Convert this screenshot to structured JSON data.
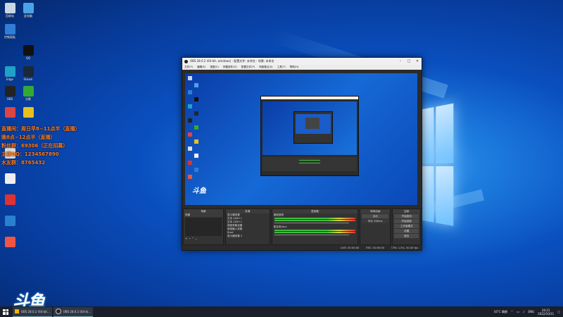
{
  "desktop": {
    "icons": [
      {
        "label": "回收站",
        "color": "#c9d6e6"
      },
      {
        "label": "此电脑",
        "color": "#4aa3e8"
      },
      {
        "label": "控制面板",
        "color": "#2e7dd6"
      },
      {
        "label": "QQ",
        "color": "#111"
      },
      {
        "label": "Edge",
        "color": "#1fa1c8"
      },
      {
        "label": "Steam",
        "color": "#1b2838"
      },
      {
        "label": "OBS",
        "color": "#222"
      },
      {
        "label": "谷歌",
        "color": "#3a3"
      },
      {
        "label": "",
        "color": "#d44"
      },
      {
        "label": "",
        "color": "#e8c020"
      },
      {
        "label": "",
        "color": "#ddd"
      },
      {
        "label": "",
        "color": "#eee"
      },
      {
        "label": "",
        "color": "#d33"
      },
      {
        "label": "",
        "color": "#2a80d0"
      },
      {
        "label": "",
        "color": "#e54"
      }
    ],
    "overlay_lines": [
      "直播间：周日早8~11点半（直播）",
      "晚8点~12点半（直播）",
      "粉丝群：69306（正在招募）",
      "主播QQ：1234567890",
      "水友群：8765432"
    ],
    "watermark": "斗鱼"
  },
  "obs": {
    "title": "OBS 28.0.2 (64-bit, windows) - 配置文件: 未命名 - 场景: 未命名",
    "menu": [
      "文件(F)",
      "编辑(E)",
      "视图(V)",
      "停靠部件(D)",
      "配置文件(P)",
      "场景集合(S)",
      "工具(T)",
      "帮助(H)"
    ],
    "docks": {
      "scenes_header": "场景",
      "scene_item": "场景",
      "sources_header": "来源",
      "sources": [
        "显示器采集",
        "文本 (GDI+)",
        "文本 (GDI+)",
        "视频采集设备",
        "音频输入采集",
        "Start",
        "显示器采集 2"
      ],
      "mixer_header": "混音器",
      "mixer_channels": [
        "桌面音频",
        "麦克风/Aux"
      ],
      "transitions_header": "转场动画",
      "transition_label": "淡出",
      "duration_label": "时长 300ms",
      "controls_header": "控制",
      "controls": [
        "开始推流",
        "开始录制",
        "工作室模式",
        "设置",
        "退出"
      ]
    },
    "status": {
      "live": "LIVE: 00:00:00",
      "rec": "REC: 00:00:00",
      "cpu": "CPU: 1.5%, 30.00 fps"
    }
  },
  "taskbar": {
    "tasks": [
      "OBS 28.0.2 (64-bit...",
      "OBS 28.0.2 (64-bi..."
    ],
    "weather": "16°C 晴朗",
    "lang": "ENG",
    "time": "20:21",
    "date": "2022/10/11"
  }
}
